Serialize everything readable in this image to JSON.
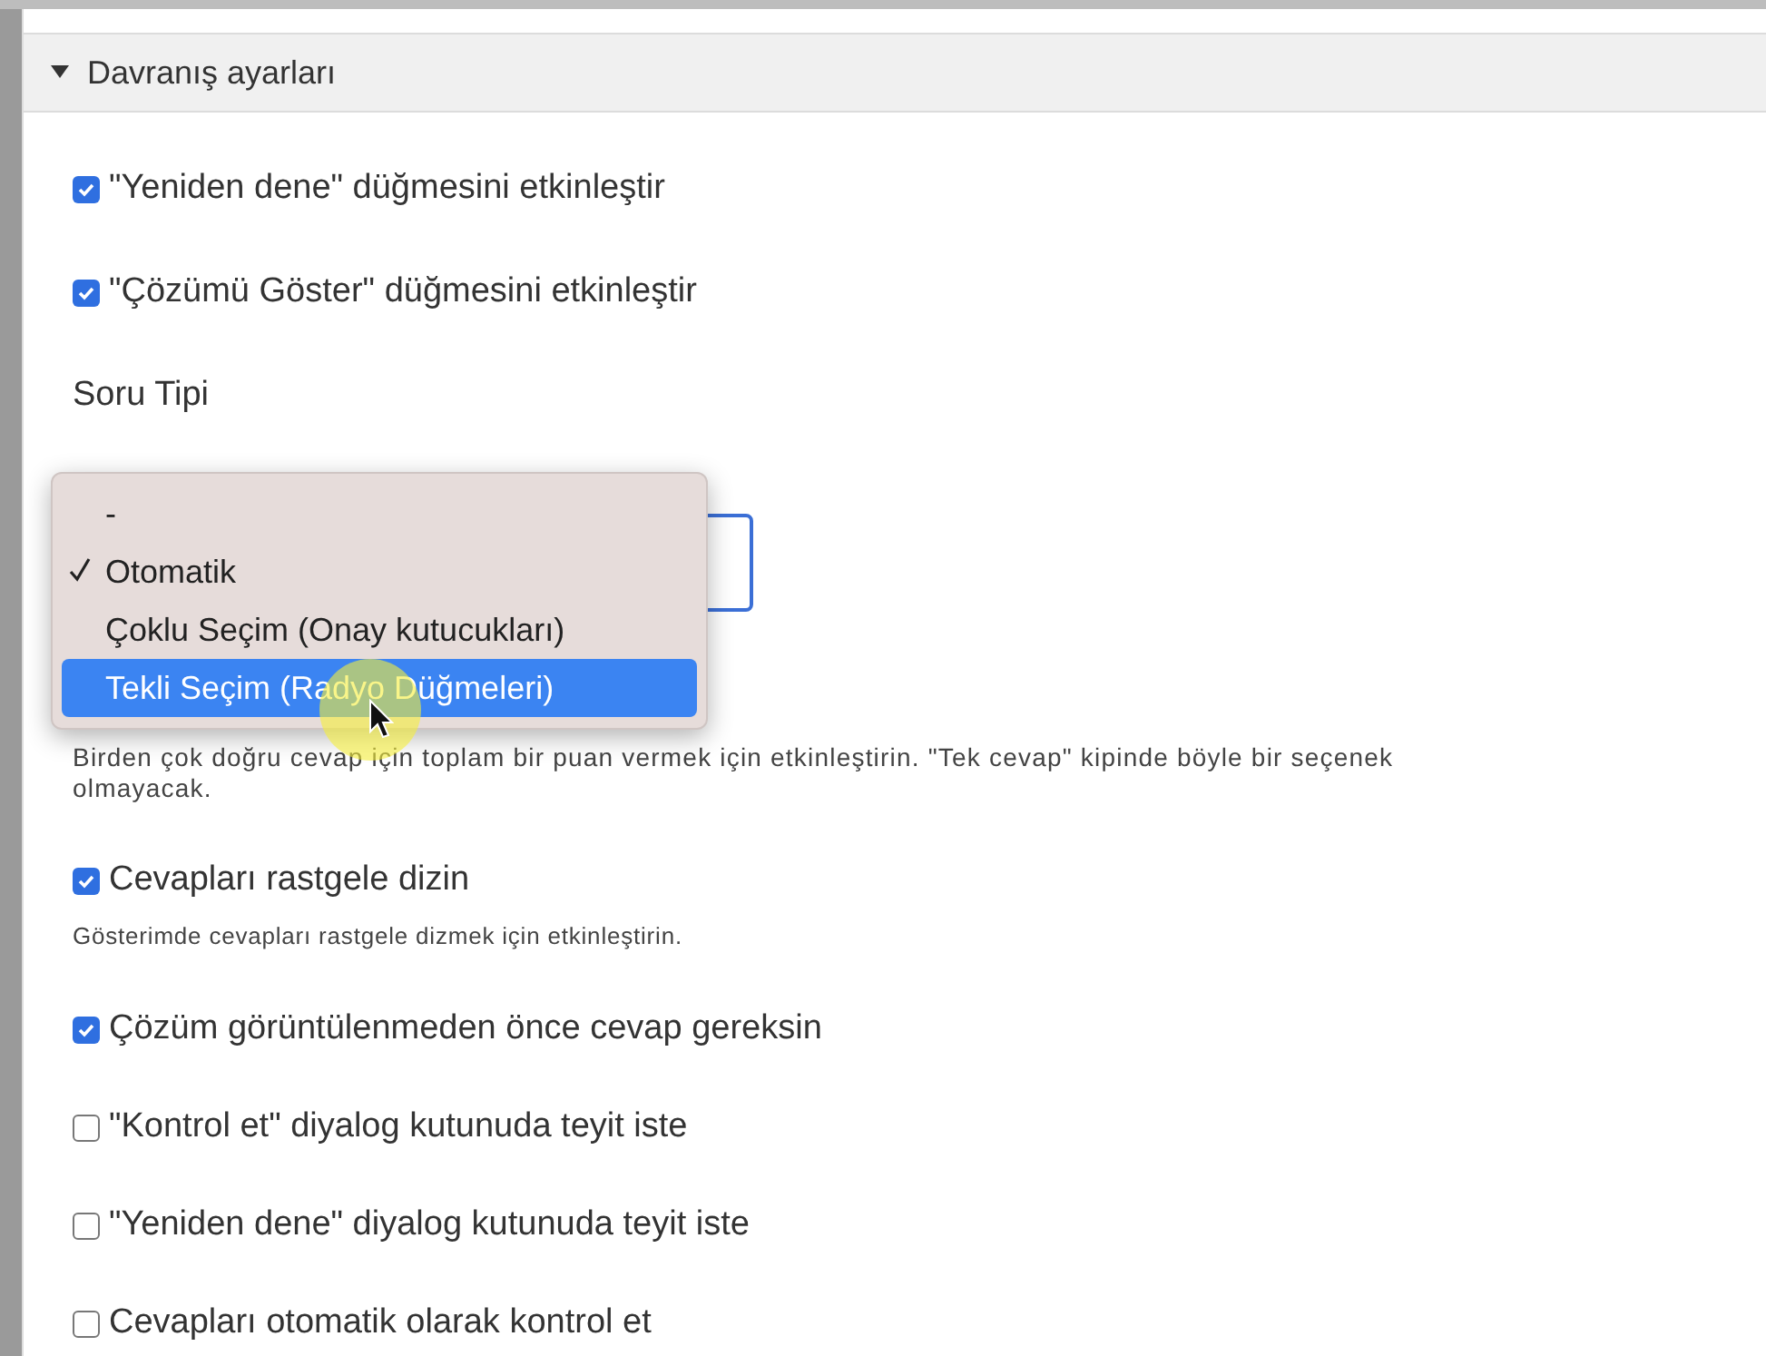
{
  "section": {
    "title": "Davranış ayarları",
    "expanded": true
  },
  "items": [
    {
      "kind": "checkbox",
      "label": "\"Yeniden dene\" düğmesini etkinleştir",
      "checked": true
    },
    {
      "kind": "checkbox",
      "label": "\"Çözümü Göster\" düğmesini etkinleştir",
      "checked": true
    },
    {
      "kind": "select",
      "label": "Soru Tipi"
    },
    {
      "kind": "note",
      "text": "Birden çok doğru cevap için toplam bir puan vermek için etkinleştirin. \"Tek cevap\" kipinde böyle bir seçenek olmayacak."
    },
    {
      "kind": "checkbox",
      "label": "Cevapları rastgele dizin",
      "checked": true,
      "description": "Gösterimde cevapları rastgele dizmek için etkinleştirin."
    },
    {
      "kind": "checkbox",
      "label": "Çözüm görüntülenmeden önce cevap gereksin",
      "checked": true
    },
    {
      "kind": "checkbox",
      "label": "\"Kontrol et\" diyalog kutunuda teyit iste",
      "checked": false
    },
    {
      "kind": "checkbox",
      "label": "\"Yeniden dene\" diyalog kutunuda teyit iste",
      "checked": false
    },
    {
      "kind": "checkbox",
      "label": "Cevapları otomatik olarak kontrol et",
      "checked": false
    }
  ],
  "dropdown": {
    "options": [
      {
        "label": "-",
        "checked": false,
        "selected": false
      },
      {
        "label": "Otomatik",
        "checked": true,
        "selected": false
      },
      {
        "label": "Çoklu Seçim (Onay kutucukları)",
        "checked": false,
        "selected": false
      },
      {
        "label": "Tekli Seçim (Radyo Düğmeleri)",
        "checked": false,
        "selected": true
      }
    ]
  }
}
